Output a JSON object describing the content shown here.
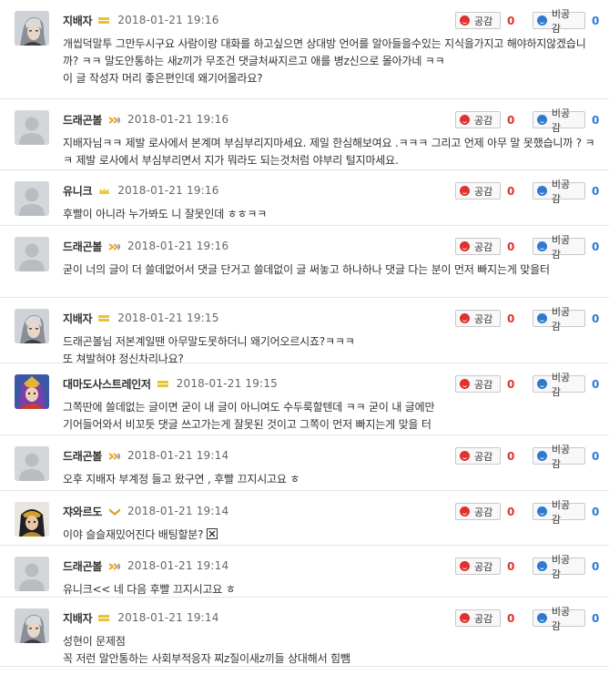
{
  "vote": {
    "up_label": "공감",
    "down_label": "비공감"
  },
  "comments": [
    {
      "nick": "지배자",
      "rank": "bar",
      "avatar": "gray-hair",
      "date": "2018-01-21  19:16",
      "up": "0",
      "down": "0",
      "text": "개씹덕말투 그만두시구요 사람이랑 대화를 하고싶으면 상대방 언어를 알아들을수있는 지식을가지고 해야하지않겠습니까? ㅋㅋ 말도안통하는 새z끼가 무조건 댓글처싸지르고 애를 병z신으로 몰아가네 ㅋㅋ\n이 글 작성자 머리 좋은편인데 왜기어올라요?"
    },
    {
      "nick": "드래곤볼",
      "rank": "wing",
      "avatar": "default",
      "date": "2018-01-21  19:16",
      "up": "0",
      "down": "0",
      "text": "지배자님ㅋㅋ 제발 로사에서 본계며 부심부리지마세요. 제일 한심해보여요 .ㅋㅋㅋ 그리고 언제 아무 말 못했습니까 ? ㅋㅋ 제발 로사에서 부심부리면서 지가 뭐라도 되는것처럼 야부리 털지마세요."
    },
    {
      "nick": "유니크",
      "rank": "crown",
      "avatar": "default",
      "date": "2018-01-21  19:16",
      "up": "0",
      "down": "0",
      "text": "후빨이 아니라 누가봐도 니 잘못인데 ㅎㅎㅋㅋ"
    },
    {
      "nick": "드래곤볼",
      "rank": "wing",
      "avatar": "default",
      "date": "2018-01-21  19:16",
      "up": "0",
      "down": "0",
      "text": "굳이 너의 글이 더 쓸데없어서 댓글 단거고 쓸데없이 글 써놓고 하나하나 댓글 다는 분이 먼저 빠지는게 맞을터"
    },
    {
      "nick": "지배자",
      "rank": "bar",
      "avatar": "gray-hair",
      "date": "2018-01-21  19:15",
      "up": "0",
      "down": "0",
      "text": "드래곤볼님 저본계일땐 아무말도못하더니 왜기어오르시죠?ㅋㅋㅋ\n또 쳐발혀야 정신차리나요?"
    },
    {
      "nick": "대마도사스트레인저",
      "rank": "bar",
      "avatar": "mage",
      "date": "2018-01-21  19:15",
      "up": "0",
      "down": "0",
      "text": "그쪽딴에 쓸데없는 글이면 굳이 내 글이 아니여도 수두룩할텐데 ㅋㅋ 굳이 내 글에만\n기어들어와서 비꼬듯 댓글 쓰고가는게 잘못된 것이고 그쪽이 먼저 빠지는게 맞을 터"
    },
    {
      "nick": "드래곤볼",
      "rank": "wing",
      "avatar": "default",
      "date": "2018-01-21  19:14",
      "up": "0",
      "down": "0",
      "text": "오후 지배자 부계정 들고 왔구연 , 후빨 끄지시고요 ㅎ"
    },
    {
      "nick": "쟈와르도",
      "rank": "chevron",
      "avatar": "warrior",
      "date": "2018-01-21  19:14",
      "up": "0",
      "down": "0",
      "text": "이야 슬슬재밌어진다 배팅할분?",
      "emoji": true
    },
    {
      "nick": "드래곤볼",
      "rank": "wing",
      "avatar": "default",
      "date": "2018-01-21  19:14",
      "up": "0",
      "down": "0",
      "text": "유니크<< 네 다음 후빨 끄지시고요 ㅎ"
    },
    {
      "nick": "지배자",
      "rank": "bar",
      "avatar": "gray-hair",
      "date": "2018-01-21  19:14",
      "up": "0",
      "down": "0",
      "text": "성현이 문제점\n꼭 저런 말안통하는 사회부적응자 찌z질이새z끼들 상대해서 힘뺌"
    }
  ]
}
